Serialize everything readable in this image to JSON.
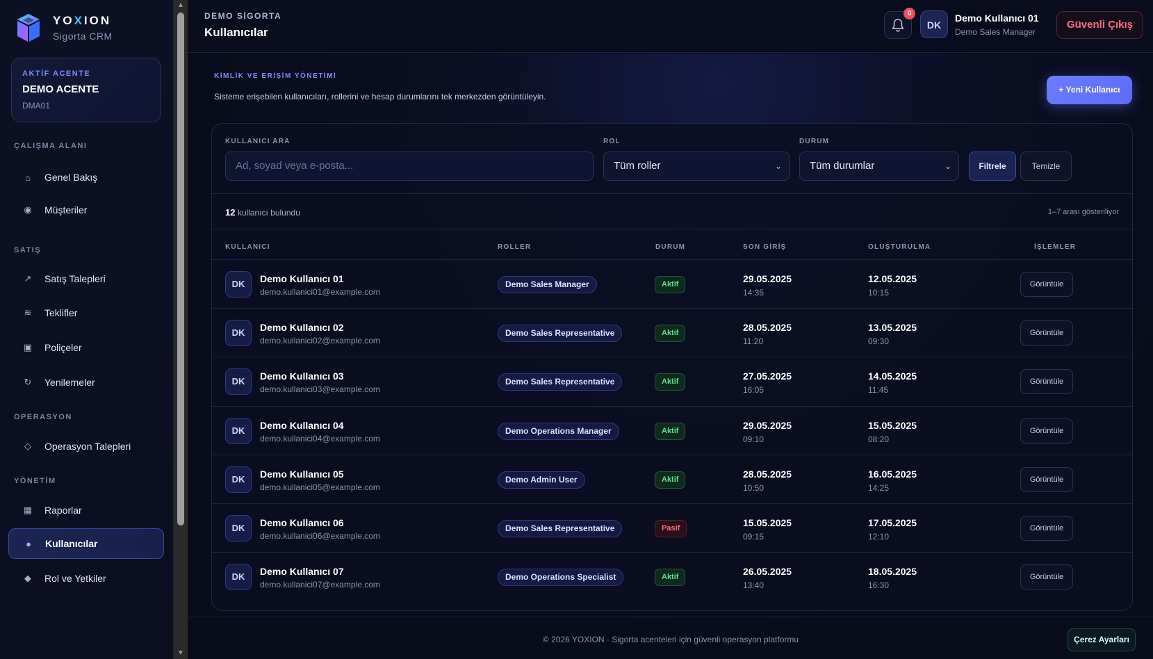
{
  "brand": {
    "name_pre": "YO",
    "name_x": "X",
    "name_post": "ION",
    "subtitle": "Sigorta CRM"
  },
  "agency": {
    "label": "AKTİF ACENTE",
    "name": "DEMO ACENTE",
    "code": "DMA01"
  },
  "nav": {
    "sections": [
      "ÇALIŞMA ALANI",
      "SATIŞ",
      "OPERASYON",
      "YÖNETİM"
    ],
    "items": [
      {
        "label": "Genel Bakış",
        "icon": "⌂"
      },
      {
        "label": "Müşteriler",
        "icon": "◉"
      },
      {
        "label": "Satış Talepleri",
        "icon": "↗"
      },
      {
        "label": "Teklifler",
        "icon": "≋"
      },
      {
        "label": "Poliçeler",
        "icon": "▣"
      },
      {
        "label": "Yenilemeler",
        "icon": "↻"
      },
      {
        "label": "Operasyon Talepleri",
        "icon": "◇"
      },
      {
        "label": "Raporlar",
        "icon": "▦"
      },
      {
        "label": "Kullanıcılar",
        "icon": "●"
      },
      {
        "label": "Rol ve Yetkiler",
        "icon": "◆"
      }
    ]
  },
  "header": {
    "org": "DEMO SİGORTA",
    "title": "Kullanıcılar",
    "notification_count": "0",
    "avatar": "DK",
    "user_name": "Demo Kullanıcı 01",
    "user_role": "Demo Sales Manager",
    "logout": "Güvenli Çıkış"
  },
  "page": {
    "eyebrow": "KİMLİK VE ERİŞİM YÖNETİMİ",
    "description": "Sisteme erişebilen kullanıcıları, rollerini ve hesap durumlarını tek merkezden görüntüleyin.",
    "new_user": "+ Yeni Kullanıcı"
  },
  "filters": {
    "search_label": "KULLANICI ARA",
    "search_placeholder": "Ad, soyad veya e-posta...",
    "role_label": "ROL",
    "role_value": "Tüm roller",
    "status_label": "DURUM",
    "status_value": "Tüm durumlar",
    "filter_btn": "Filtrele",
    "clear_btn": "Temizle"
  },
  "summary": {
    "count": "12",
    "count_suffix": "kullanıcı bulundu",
    "range": "1–7 arası gösteriliyor"
  },
  "table": {
    "headers": [
      "KULLANICI",
      "ROLLER",
      "DURUM",
      "SON GİRİŞ",
      "OLUŞTURULMA",
      "İŞLEMLER"
    ],
    "action_label": "Görüntüle",
    "rows": [
      {
        "initials": "DK",
        "name": "Demo Kullanıcı 01",
        "email": "demo.kullanici01@example.com",
        "role": "Demo Sales Manager",
        "status": "Aktif",
        "status_type": "active",
        "last_date": "29.05.2025",
        "last_time": "14:35",
        "created_date": "12.05.2025",
        "created_time": "10:15"
      },
      {
        "initials": "DK",
        "name": "Demo Kullanıcı 02",
        "email": "demo.kullanici02@example.com",
        "role": "Demo Sales Representative",
        "status": "Aktif",
        "status_type": "active",
        "last_date": "28.05.2025",
        "last_time": "11:20",
        "created_date": "13.05.2025",
        "created_time": "09:30"
      },
      {
        "initials": "DK",
        "name": "Demo Kullanıcı 03",
        "email": "demo.kullanici03@example.com",
        "role": "Demo Sales Representative",
        "status": "Aktif",
        "status_type": "active",
        "last_date": "27.05.2025",
        "last_time": "16:05",
        "created_date": "14.05.2025",
        "created_time": "11:45"
      },
      {
        "initials": "DK",
        "name": "Demo Kullanıcı 04",
        "email": "demo.kullanici04@example.com",
        "role": "Demo Operations Manager",
        "status": "Aktif",
        "status_type": "active",
        "last_date": "29.05.2025",
        "last_time": "09:10",
        "created_date": "15.05.2025",
        "created_time": "08:20"
      },
      {
        "initials": "DK",
        "name": "Demo Kullanıcı 05",
        "email": "demo.kullanici05@example.com",
        "role": "Demo Admin User",
        "status": "Aktif",
        "status_type": "active",
        "last_date": "28.05.2025",
        "last_time": "10:50",
        "created_date": "16.05.2025",
        "created_time": "14:25"
      },
      {
        "initials": "DK",
        "name": "Demo Kullanıcı 06",
        "email": "demo.kullanici06@example.com",
        "role": "Demo Sales Representative",
        "status": "Pasif",
        "status_type": "passive",
        "last_date": "15.05.2025",
        "last_time": "09:15",
        "created_date": "17.05.2025",
        "created_time": "12:10"
      },
      {
        "initials": "DK",
        "name": "Demo Kullanıcı 07",
        "email": "demo.kullanici07@example.com",
        "role": "Demo Operations Specialist",
        "status": "Aktif",
        "status_type": "active",
        "last_date": "26.05.2025",
        "last_time": "13:40",
        "created_date": "18.05.2025",
        "created_time": "16:30"
      }
    ]
  },
  "footer": {
    "text": "© 2026 YOXION · Sigorta acenteleri için güvenli operasyon platformu",
    "cookie_btn": "Çerez Ayarları"
  },
  "colors": {
    "accent": "#6b7dff",
    "active": "#5fe08f",
    "passive": "#ff6b7d",
    "background": "#070b1a"
  }
}
